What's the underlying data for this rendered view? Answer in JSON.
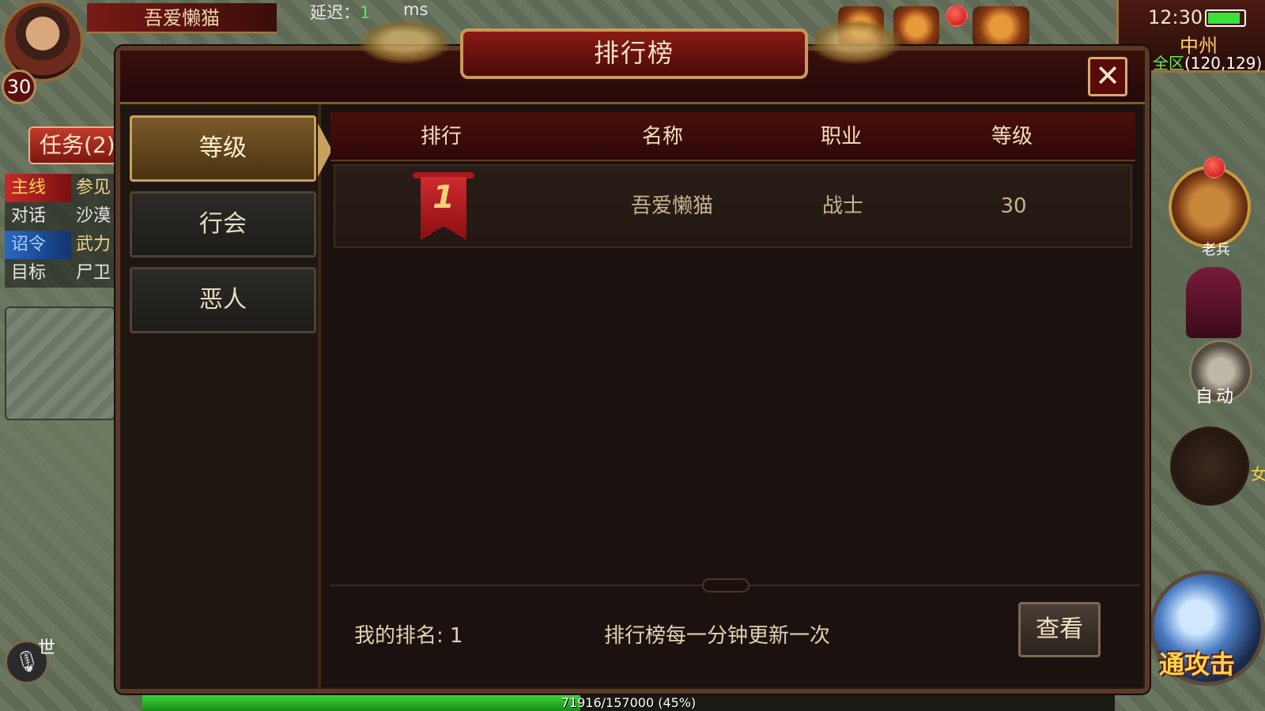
{
  "hud": {
    "player_name": "吾爱懒猫",
    "player_level": "30",
    "latency_label": "延迟：",
    "latency_value": "1",
    "latency_unit": "ms",
    "task_button": "任务(2)",
    "tasks": [
      {
        "tag": "主线",
        "text": "参见"
      },
      {
        "tag": "对话",
        "text": "沙漠"
      },
      {
        "tag": "诏令",
        "text": "武力"
      },
      {
        "tag": "目标",
        "text": "尸卫"
      }
    ],
    "clock": "12:30",
    "battery_percent": 90,
    "zone": "中州",
    "coords_prefix": "全区",
    "coords": "(120,129)",
    "box_label": "老兵",
    "auto_label": "自动",
    "skill_side_text": "女",
    "attack_label": "通攻击",
    "chat_channel": "世",
    "xp_text": "71916/157000 (45%)",
    "xp_fraction": 0.45
  },
  "modal": {
    "title": "排行榜",
    "close_glyph": "✕",
    "tabs": [
      {
        "label": "等级",
        "active": true
      },
      {
        "label": "行会",
        "active": false
      },
      {
        "label": "恶人",
        "active": false
      }
    ],
    "columns": [
      "排行",
      "名称",
      "职业",
      "等级"
    ],
    "rows": [
      {
        "rank": "1",
        "name": "吾爱懒猫",
        "class": "战士",
        "level": "30"
      }
    ],
    "my_rank": "我的排名: 1",
    "update_note": "排行榜每一分钟更新一次",
    "view_button": "查看"
  },
  "colors": {
    "accent_gold": "#c8a25c",
    "header_red": "#4a0f0c",
    "latency_green": "#58e858"
  }
}
